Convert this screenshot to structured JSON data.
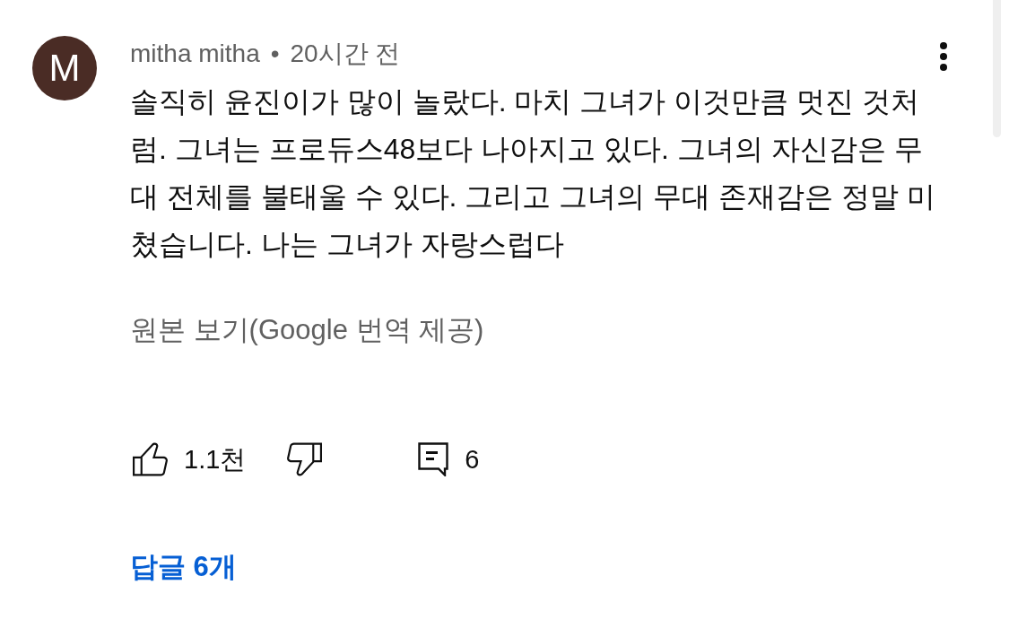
{
  "comment": {
    "avatar_letter": "M",
    "author": "mitha mitha",
    "separator": "•",
    "time": "20시간 전",
    "text": "솔직히 윤진이가 많이 놀랐다. 마치 그녀가 이것만큼 멋진 것처럼. 그녀는 프로듀스48보다 나아지고 있다. 그녀의 자신감은 무대 전체를 불태울 수 있다. 그리고 그녀의 무대 존재감은 정말 미쳤습니다. 나는 그녀가 자랑스럽다",
    "translation_link": "원본 보기(Google 번역 제공)",
    "likes": "1.1천",
    "reply_count": "6",
    "replies_link": "답글 6개"
  }
}
